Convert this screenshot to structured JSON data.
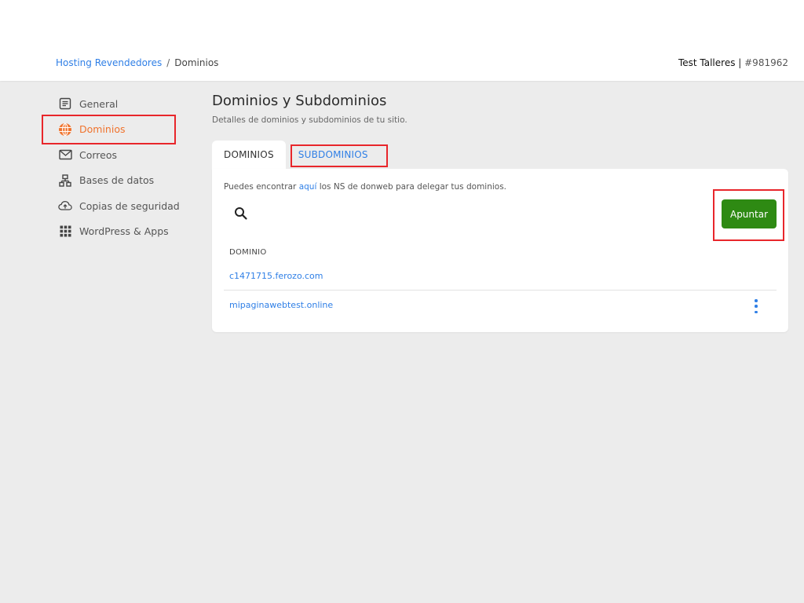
{
  "header": {
    "breadcrumb": {
      "parent": "Hosting Revendedores",
      "separator": "/",
      "current": "Dominios"
    },
    "account": {
      "name": "Test Talleres",
      "separator": " | ",
      "id": "#981962"
    }
  },
  "sidebar": {
    "items": [
      {
        "label": "General",
        "icon": "document-icon"
      },
      {
        "label": "Dominios",
        "icon": "globe-icon"
      },
      {
        "label": "Correos",
        "icon": "mail-icon"
      },
      {
        "label": "Bases de datos",
        "icon": "database-network-icon"
      },
      {
        "label": "Copias de seguridad",
        "icon": "cloud-upload-icon"
      },
      {
        "label": "WordPress & Apps",
        "icon": "apps-grid-icon"
      }
    ],
    "active_color": "#f0732d"
  },
  "main": {
    "title": "Dominios y Subdominios",
    "subtitle": "Detalles de dominios y subdominios de tu sitio.",
    "tabs": [
      {
        "label": "DOMINIOS"
      },
      {
        "label": "SUBDOMINIOS"
      }
    ],
    "info": {
      "before": "Puedes encontrar ",
      "link": "aquí",
      "after": " los NS de donweb para delegar tus dominios."
    },
    "apuntar_label": "Apuntar",
    "table": {
      "header": "DOMINIO",
      "rows": [
        {
          "domain": "c1471715.ferozo.com"
        },
        {
          "domain": "mipaginawebtest.online"
        }
      ]
    }
  },
  "colors": {
    "link": "#2f7fe6",
    "button": "#2e8a13",
    "annotation": "#e8262b"
  }
}
